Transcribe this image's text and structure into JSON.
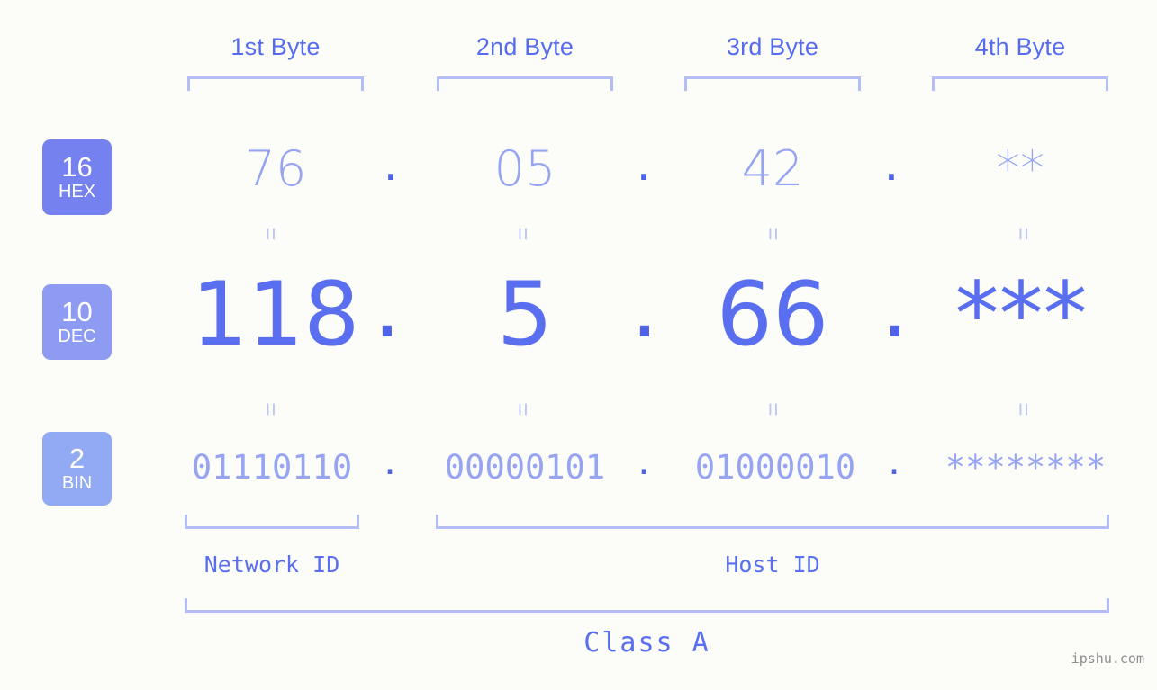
{
  "background_color": "#fcfdf9",
  "accent_color": "#5a6ff0",
  "muted_accent_color": "#97a4f2",
  "bracket_color": "#b4bdf5",
  "header": {
    "byte_labels": [
      {
        "label": "1st Byte"
      },
      {
        "label": "2nd Byte"
      },
      {
        "label": "3rd Byte"
      },
      {
        "label": "4th Byte"
      }
    ]
  },
  "bases": [
    {
      "number": "16",
      "abbr": "HEX",
      "color": "#7481ee"
    },
    {
      "number": "10",
      "abbr": "DEC",
      "color": "#8e9bf2"
    },
    {
      "number": "2",
      "abbr": "BIN",
      "color": "#92a9f4"
    }
  ],
  "rows": {
    "hex": {
      "octets": [
        "76",
        "05",
        "42",
        "**"
      ],
      "separator": "."
    },
    "dec": {
      "octets": [
        "118",
        "5",
        "66",
        "***"
      ],
      "separator": "."
    },
    "bin": {
      "octets": [
        "01110110",
        "00000101",
        "01000010",
        "********"
      ],
      "separator": "."
    }
  },
  "equals_symbol": "=",
  "footer": {
    "network_id_label": "Network ID",
    "host_id_label": "Host ID",
    "class_label": "Class A"
  },
  "watermark": "ipshu.com"
}
